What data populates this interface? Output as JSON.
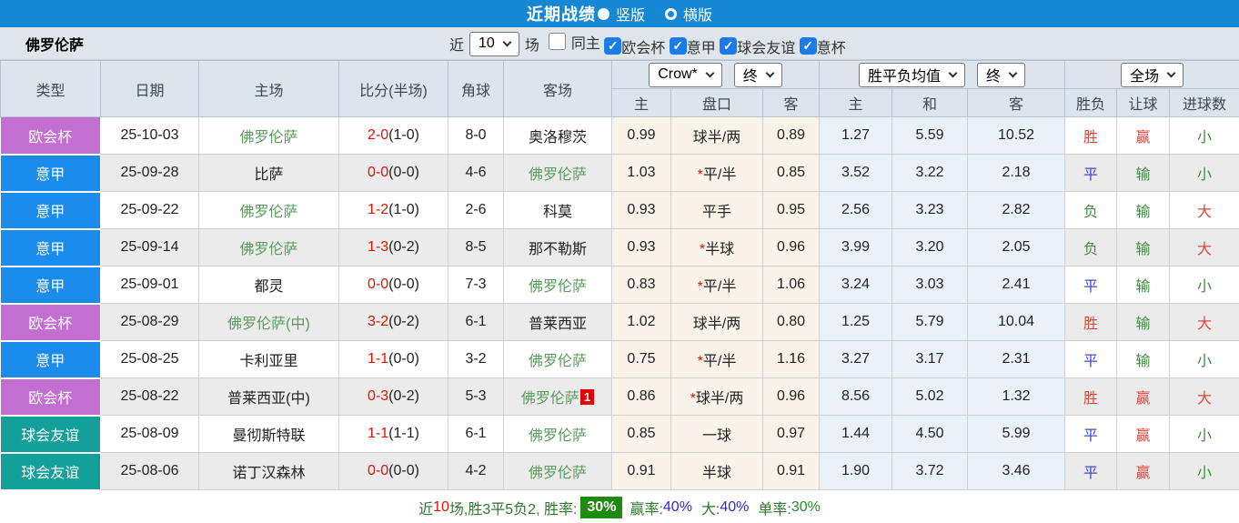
{
  "top_bar": {
    "title": "近期战绩",
    "radio_vertical": "竖版",
    "radio_horizontal": "横版",
    "selected": "竖版"
  },
  "filter_bar": {
    "team_name": "佛罗伦萨",
    "recent_label": "近",
    "recent_count": "10",
    "matches_label": "场",
    "checkboxes": [
      {
        "label": "同主",
        "checked": false
      },
      {
        "label": "欧会杯",
        "checked": true
      },
      {
        "label": "意甲",
        "checked": true
      },
      {
        "label": "球会友谊",
        "checked": true
      },
      {
        "label": "意杯",
        "checked": true
      }
    ]
  },
  "table": {
    "main_headers": [
      "类型",
      "日期",
      "主场",
      "比分(半场)",
      "角球",
      "客场"
    ],
    "odds_source_select": "Crow*",
    "odds_period_select": "终",
    "europe_source_select": "胜平负均值",
    "europe_period_select": "终",
    "scope_select": "全场",
    "sub_headers": [
      "主",
      "盘口",
      "客",
      "主",
      "和",
      "客",
      "胜负",
      "让球",
      "进球数"
    ],
    "rows": [
      {
        "league": "欧会杯",
        "league_color": "purple",
        "date": "25-10-03",
        "home": "佛罗伦萨",
        "home_is_team": true,
        "score": "2-0",
        "half": "(1-0)",
        "corners": "8-0",
        "away": "奥洛穆茨",
        "away_is_team": false,
        "away_badge": "",
        "odds_home": "0.99",
        "handicap": "球半/两",
        "odds_away": "0.89",
        "eu_home": "1.27",
        "eu_draw": "5.59",
        "eu_away": "10.52",
        "result": "胜",
        "result_color": "red",
        "handicap_result": "赢",
        "handicap_result_color": "red",
        "goals": "小",
        "goals_color": "green"
      },
      {
        "league": "意甲",
        "league_color": "blue",
        "date": "25-09-28",
        "home": "比萨",
        "home_is_team": false,
        "score": "0-0",
        "half": "(0-0)",
        "corners": "4-6",
        "away": "佛罗伦萨",
        "away_is_team": true,
        "away_badge": "",
        "odds_home": "1.03",
        "handicap": "*平/半",
        "odds_away": "0.85",
        "eu_home": "3.52",
        "eu_draw": "3.22",
        "eu_away": "2.18",
        "result": "平",
        "result_color": "blue",
        "handicap_result": "输",
        "handicap_result_color": "green",
        "goals": "小",
        "goals_color": "green"
      },
      {
        "league": "意甲",
        "league_color": "blue",
        "date": "25-09-22",
        "home": "佛罗伦萨",
        "home_is_team": true,
        "score": "1-2",
        "half": "(1-0)",
        "corners": "2-6",
        "away": "科莫",
        "away_is_team": false,
        "away_badge": "",
        "odds_home": "0.93",
        "handicap": "平手",
        "odds_away": "0.95",
        "eu_home": "2.56",
        "eu_draw": "3.23",
        "eu_away": "2.82",
        "result": "负",
        "result_color": "green",
        "handicap_result": "输",
        "handicap_result_color": "green",
        "goals": "大",
        "goals_color": "red"
      },
      {
        "league": "意甲",
        "league_color": "blue",
        "date": "25-09-14",
        "home": "佛罗伦萨",
        "home_is_team": true,
        "score": "1-3",
        "half": "(0-2)",
        "corners": "8-5",
        "away": "那不勒斯",
        "away_is_team": false,
        "away_badge": "",
        "odds_home": "0.93",
        "handicap": "*半球",
        "odds_away": "0.96",
        "eu_home": "3.99",
        "eu_draw": "3.20",
        "eu_away": "2.05",
        "result": "负",
        "result_color": "green",
        "handicap_result": "输",
        "handicap_result_color": "green",
        "goals": "大",
        "goals_color": "red"
      },
      {
        "league": "意甲",
        "league_color": "blue",
        "date": "25-09-01",
        "home": "都灵",
        "home_is_team": false,
        "score": "0-0",
        "half": "(0-0)",
        "corners": "7-3",
        "away": "佛罗伦萨",
        "away_is_team": true,
        "away_badge": "",
        "odds_home": "0.83",
        "handicap": "*平/半",
        "odds_away": "1.06",
        "eu_home": "3.24",
        "eu_draw": "3.03",
        "eu_away": "2.41",
        "result": "平",
        "result_color": "blue",
        "handicap_result": "输",
        "handicap_result_color": "green",
        "goals": "小",
        "goals_color": "green"
      },
      {
        "league": "欧会杯",
        "league_color": "purple",
        "date": "25-08-29",
        "home": "佛罗伦萨(中)",
        "home_is_team": true,
        "score": "3-2",
        "half": "(0-2)",
        "corners": "6-1",
        "away": "普莱西亚",
        "away_is_team": false,
        "away_badge": "",
        "odds_home": "1.02",
        "handicap": "球半/两",
        "odds_away": "0.80",
        "eu_home": "1.25",
        "eu_draw": "5.79",
        "eu_away": "10.04",
        "result": "胜",
        "result_color": "red",
        "handicap_result": "输",
        "handicap_result_color": "green",
        "goals": "大",
        "goals_color": "red"
      },
      {
        "league": "意甲",
        "league_color": "blue",
        "date": "25-08-25",
        "home": "卡利亚里",
        "home_is_team": false,
        "score": "1-1",
        "half": "(0-0)",
        "corners": "3-2",
        "away": "佛罗伦萨",
        "away_is_team": true,
        "away_badge": "",
        "odds_home": "0.75",
        "handicap": "*平/半",
        "odds_away": "1.16",
        "eu_home": "3.27",
        "eu_draw": "3.17",
        "eu_away": "2.31",
        "result": "平",
        "result_color": "blue",
        "handicap_result": "输",
        "handicap_result_color": "green",
        "goals": "小",
        "goals_color": "green"
      },
      {
        "league": "欧会杯",
        "league_color": "purple",
        "date": "25-08-22",
        "home": "普莱西亚(中)",
        "home_is_team": false,
        "score": "0-3",
        "half": "(0-2)",
        "corners": "5-3",
        "away": "佛罗伦萨",
        "away_is_team": true,
        "away_badge": "1",
        "odds_home": "0.86",
        "handicap": "*球半/两",
        "odds_away": "0.96",
        "eu_home": "8.56",
        "eu_draw": "5.02",
        "eu_away": "1.32",
        "result": "胜",
        "result_color": "red",
        "handicap_result": "赢",
        "handicap_result_color": "red",
        "goals": "大",
        "goals_color": "red"
      },
      {
        "league": "球会友谊",
        "league_color": "teal",
        "date": "25-08-09",
        "home": "曼彻斯特联",
        "home_is_team": false,
        "score": "1-1",
        "half": "(1-1)",
        "corners": "6-1",
        "away": "佛罗伦萨",
        "away_is_team": true,
        "away_badge": "",
        "odds_home": "0.85",
        "handicap": "一球",
        "odds_away": "0.97",
        "eu_home": "1.44",
        "eu_draw": "4.50",
        "eu_away": "5.99",
        "result": "平",
        "result_color": "blue",
        "handicap_result": "赢",
        "handicap_result_color": "red",
        "goals": "小",
        "goals_color": "green"
      },
      {
        "league": "球会友谊",
        "league_color": "teal",
        "date": "25-08-06",
        "home": "诺丁汉森林",
        "home_is_team": false,
        "score": "0-0",
        "half": "(0-0)",
        "corners": "4-2",
        "away": "佛罗伦萨",
        "away_is_team": true,
        "away_badge": "",
        "odds_home": "0.91",
        "handicap": "半球",
        "odds_away": "0.91",
        "eu_home": "1.90",
        "eu_draw": "3.72",
        "eu_away": "3.46",
        "result": "平",
        "result_color": "blue",
        "handicap_result": "赢",
        "handicap_result_color": "red",
        "goals": "小",
        "goals_color": "green"
      }
    ]
  },
  "summary": {
    "prefix": "近",
    "count": "10",
    "mid": "场,胜3平5负2, 胜率:",
    "win_rate": "30%",
    "win_label": "赢率:",
    "win_value": "40%",
    "big_label": "大:",
    "big_value": "40%",
    "single_label": "单率:",
    "single_value": "30%"
  },
  "colors": {
    "top_bar": "#1687d3",
    "league_europa_conference": "#c36fd2",
    "league_serie_a": "#1b8ceb",
    "league_friendly": "#14a09a",
    "team_highlight_green": "#5a9b5c",
    "score_red": "#e81000",
    "result_win_red": "#e0463a",
    "result_draw_blue": "#4245d6",
    "result_lose_green": "#3f8c42",
    "odds_columns_bg": "#f9f3ea",
    "europe_columns_bg": "#eaf2f9",
    "win_rate_badge_bg": "#1e8a0e"
  }
}
